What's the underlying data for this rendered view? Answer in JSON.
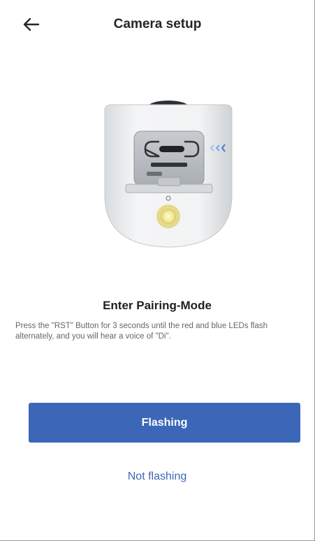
{
  "header": {
    "back_icon": "arrow-left-icon",
    "title": "Camera setup"
  },
  "illustration": {
    "icon": "camera-device-illustration",
    "led_color": "#f3ec9a",
    "signal_color": "#3c79d6"
  },
  "content": {
    "heading": "Enter Pairing-Mode",
    "description": "Press the \"RST\" Button for 3 seconds until the red and blue LEDs flash alternately, and you will hear a voice of \"Di\"."
  },
  "actions": {
    "primary_label": "Flashing",
    "secondary_label": "Not flashing"
  },
  "colors": {
    "accent": "#3c67b9",
    "link": "#3f67b8"
  }
}
